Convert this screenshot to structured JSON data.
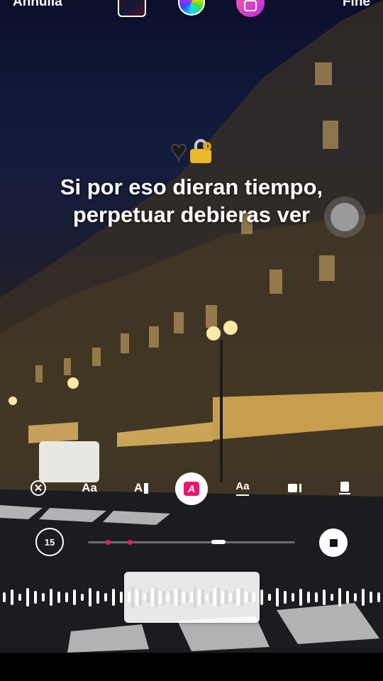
{
  "header": {
    "cancel_label": "Annulla",
    "done_label": "Fine"
  },
  "icons": {
    "album_art": "album-cover",
    "color_wheel": "color-wheel-icon",
    "sticker": "sticker-icon"
  },
  "overlay": {
    "emoji": "🖤🔐",
    "lyrics": "Si por eso dieran tiempo, perpetuar debieras ver"
  },
  "toolbar": {
    "remove_label": "✕",
    "text_style_label": "Aa",
    "text_align_label": "A",
    "highlight_label": "A",
    "animation_label": "Aa",
    "accent_color": "#e6196b"
  },
  "duration": {
    "seconds_label": "15"
  },
  "colors": {
    "accent": "#e6196b",
    "text": "#ffffff"
  }
}
